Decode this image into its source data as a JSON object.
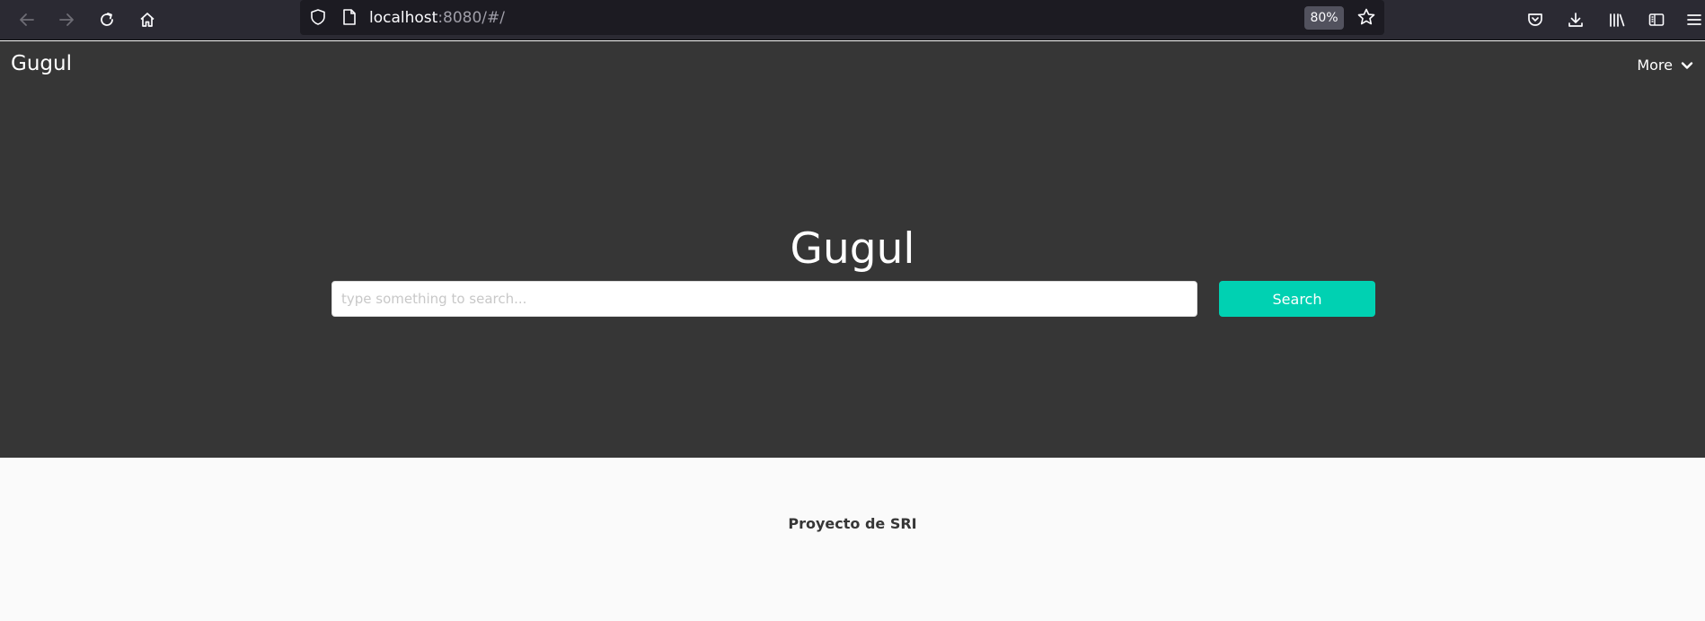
{
  "browser": {
    "url_host": "localhost",
    "url_rest": ":8080/#/",
    "zoom": "80%"
  },
  "navbar": {
    "brand": "Gugul",
    "more_label": "More"
  },
  "hero": {
    "title": "Gugul",
    "search_placeholder": "type something to search...",
    "search_button": "Search"
  },
  "footer": {
    "text": "Proyecto de SRI"
  },
  "colors": {
    "toolbar_bg": "#2b2a33",
    "urlbar_bg": "#1c1b22",
    "hero_bg": "#363636",
    "accent": "#00d1b2",
    "footer_bg": "#fafafa"
  },
  "icons": [
    "back-icon",
    "forward-icon",
    "reload-icon",
    "home-icon",
    "shield-icon",
    "page-icon",
    "star-icon",
    "pocket-icon",
    "download-icon",
    "library-icon",
    "sidebar-icon",
    "menu-icon",
    "chevron-down-icon"
  ]
}
